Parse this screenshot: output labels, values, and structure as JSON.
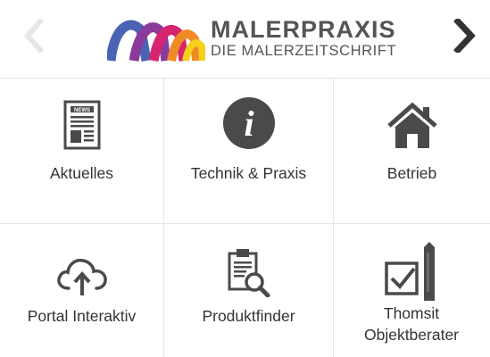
{
  "header": {
    "brand_name": "MALERPRAXIS",
    "brand_tagline": "DIE MALERZEITSCHRIFT",
    "prev_icon": "chevron-left-icon",
    "next_icon": "chevron-right-icon"
  },
  "tiles": [
    {
      "label": "Aktuelles",
      "icon": "newspaper-icon"
    },
    {
      "label": "Technik & Praxis",
      "icon": "info-icon"
    },
    {
      "label": "Betrieb",
      "icon": "home-icon"
    },
    {
      "label": "Portal Interaktiv",
      "icon": "cloud-upload-icon"
    },
    {
      "label": "Produktfinder",
      "icon": "clipboard-search-icon"
    },
    {
      "label": "Thomsit Objektberater",
      "icon": "checkbox-pencil-icon"
    }
  ],
  "colors": {
    "icon": "#4a4a4a",
    "text": "#333333",
    "divider": "#e6e6e6",
    "arrow_inactive": "#e6e6e6",
    "arrow_active": "#333333",
    "logo_blue": "#4a63b5",
    "logo_purple": "#8a3a9a",
    "logo_magenta": "#d6246e",
    "logo_orange": "#f08a24",
    "logo_yellow": "#f5d11c"
  }
}
